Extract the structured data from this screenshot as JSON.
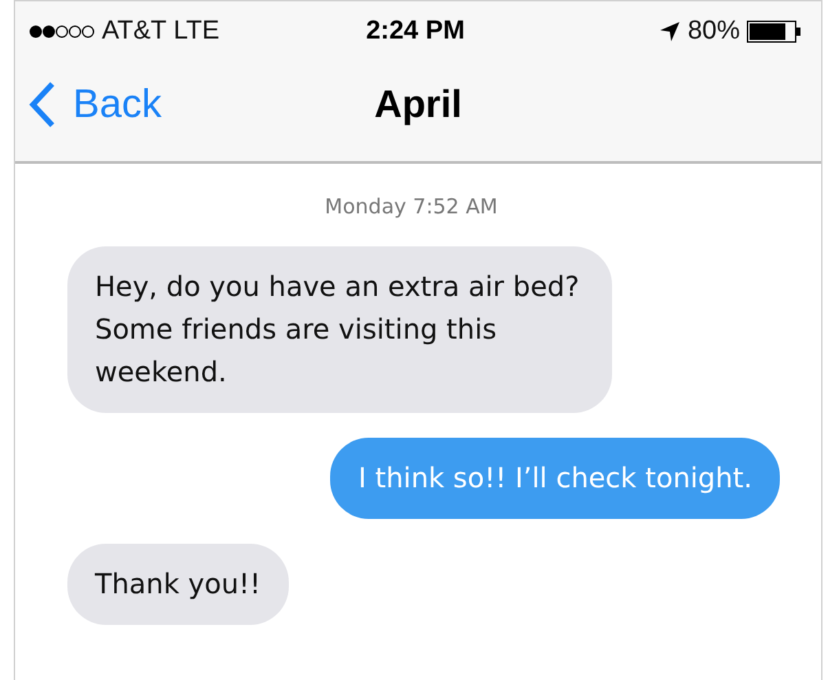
{
  "status_bar": {
    "carrier": "AT&T LTE",
    "time": "2:24 PM",
    "battery": "80%"
  },
  "nav": {
    "back": "Back",
    "title": "April"
  },
  "timestamp": "Monday 7:52 AM",
  "messages": [
    {
      "kind": "incoming",
      "text": "Hey, do you have an extra air bed? Some friends are visiting this weekend."
    },
    {
      "kind": "outgoing",
      "text": "I think so!! I’ll check tonight."
    },
    {
      "kind": "incoming",
      "text": "Thank you!!"
    }
  ]
}
